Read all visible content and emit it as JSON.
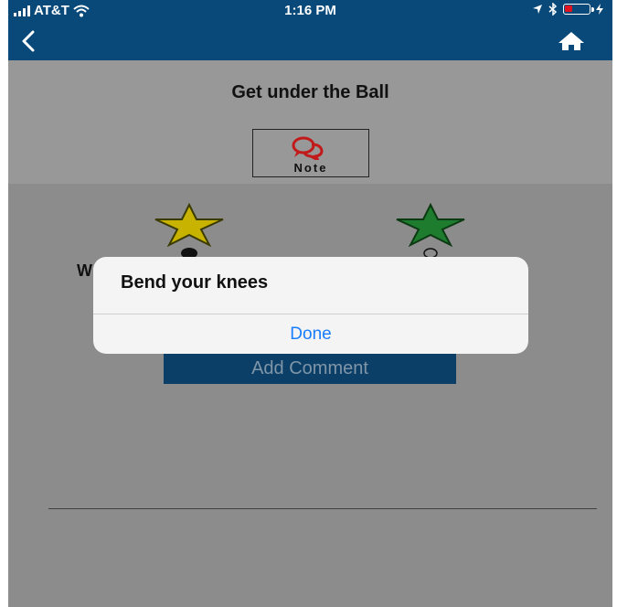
{
  "status_bar": {
    "carrier": "AT&T",
    "time": "1:16 PM",
    "battery_color": "#e0131f"
  },
  "nav": {
    "back_icon": "chevron-left-icon",
    "home_icon": "home-icon",
    "bar_color": "#08497a"
  },
  "header": {
    "title": "Get under the Ball",
    "note_button": {
      "label": "Note",
      "icon": "speech-bubbles-icon"
    }
  },
  "rating": {
    "options": [
      {
        "star_color": "#c8b400",
        "selected": true
      },
      {
        "star_color": "#1e7c2e",
        "selected": false
      }
    ],
    "obscured_label_fragment": "W"
  },
  "add_comment_label": "Add Comment",
  "dialog": {
    "message": "Bend your knees",
    "done_label": "Done"
  }
}
